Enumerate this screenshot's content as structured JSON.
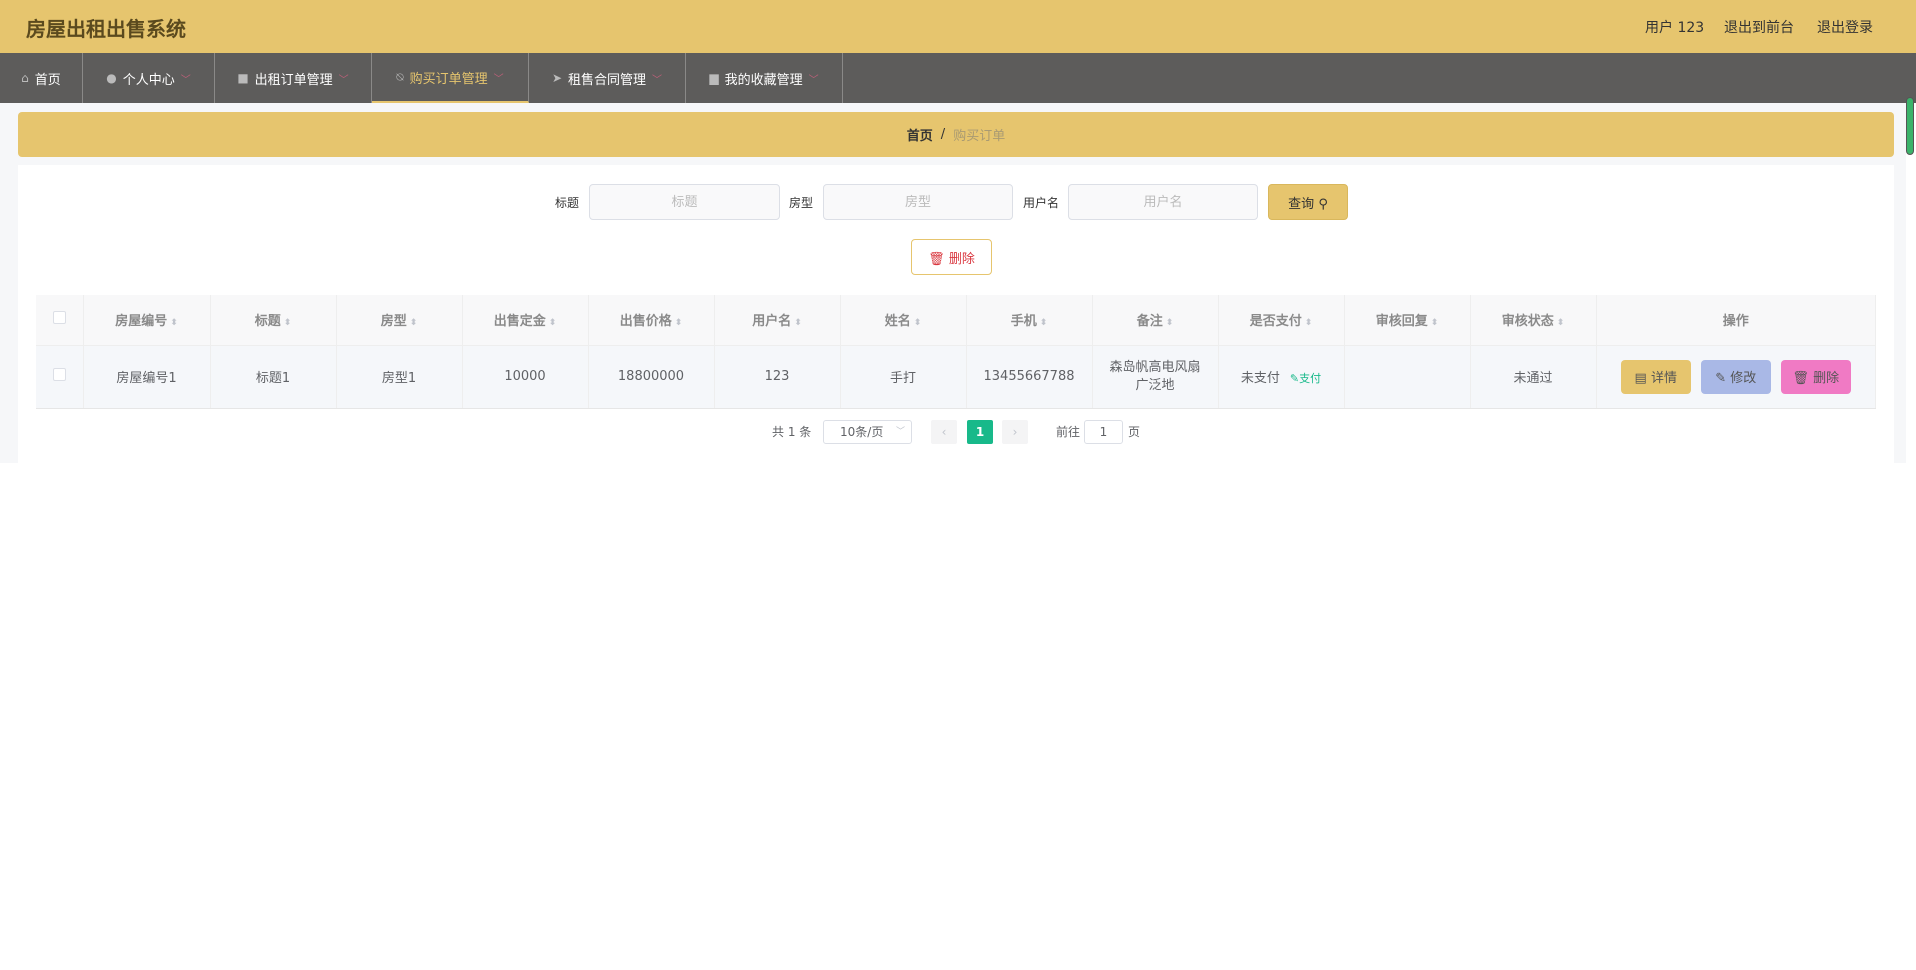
{
  "header": {
    "title": "房屋出租出售系统",
    "user": "用户 123",
    "to_front": "退出到前台",
    "logout": "退出登录"
  },
  "nav": [
    {
      "label": "首页",
      "icon": "home-icon"
    },
    {
      "label": "个人中心",
      "icon": "user-icon"
    },
    {
      "label": "出租订单管理",
      "icon": "briefcase-icon"
    },
    {
      "label": "购买订单管理",
      "icon": "bell-off-icon",
      "active": true
    },
    {
      "label": "租售合同管理",
      "icon": "send-icon"
    },
    {
      "label": "我的收藏管理",
      "icon": "monitor-icon"
    }
  ],
  "breadcrumb": {
    "home": "首页",
    "sep": "/",
    "current": "购买订单"
  },
  "search": {
    "title_label": "标题",
    "title_placeholder": "标题",
    "type_label": "房型",
    "type_placeholder": "房型",
    "user_label": "用户名",
    "user_placeholder": "用户名",
    "query": "查询"
  },
  "delete_label": "删除",
  "table": {
    "headers": [
      "房屋编号",
      "标题",
      "房型",
      "出售定金",
      "出售价格",
      "用户名",
      "姓名",
      "手机",
      "备注",
      "是否支付",
      "审核回复",
      "审核状态",
      "操作"
    ],
    "rows": [
      {
        "house_no": "房屋编号1",
        "title": "标题1",
        "type": "房型1",
        "deposit": "10000",
        "price": "18800000",
        "username": "123",
        "name": "手打",
        "phone": "13455667788",
        "remark": "森岛帆高电风扇广泛地",
        "paid": "未支付",
        "pay_link": "支付",
        "reply": "",
        "status": "未通过",
        "detail": "详情",
        "edit": "修改",
        "delete": "删除"
      }
    ]
  },
  "pagination": {
    "total": "共 1 条",
    "page_size": "10条/页",
    "current": "1",
    "goto": "前往",
    "goto_value": "1",
    "page_unit": "页"
  },
  "colors": {
    "brand": "#e6c56e",
    "nav": "#5d5c5b",
    "page_active": "#18b98a",
    "detail": "#e6c56e",
    "edit": "#a9b8e6",
    "delete": "#f07ac4"
  }
}
